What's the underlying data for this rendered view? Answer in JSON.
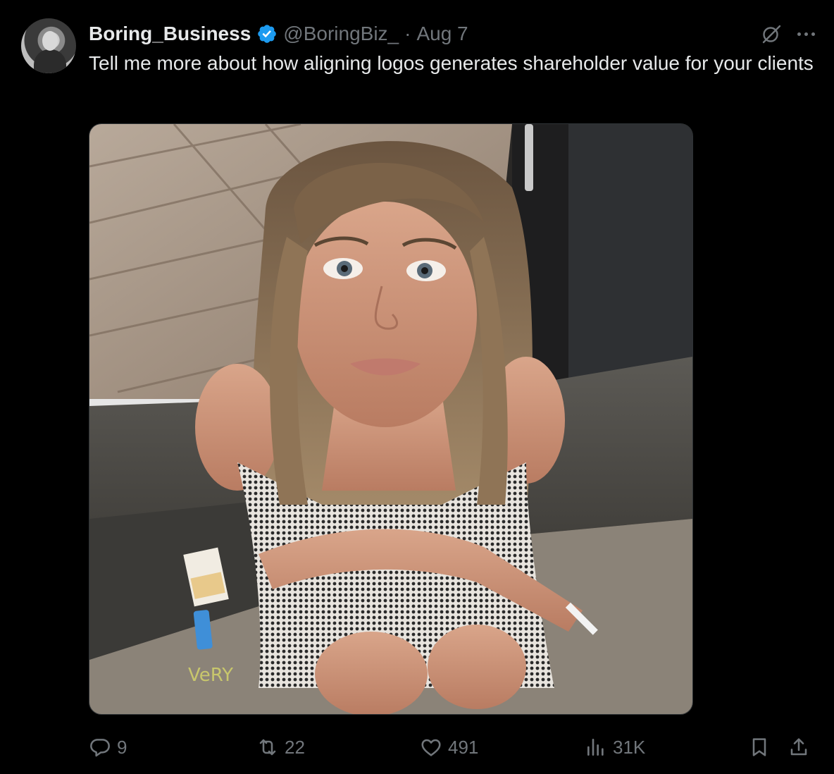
{
  "tweet": {
    "author_name": "Boring_Business",
    "handle": "@BoringBiz_",
    "separator": "·",
    "date": "Aug 7",
    "text": "Tell me more about how aligning logos generates shareholder value for your clients",
    "media_icons": {
      "verified": "verified-badge-icon",
      "grok": "grok-icon",
      "more": "more-icon"
    }
  },
  "media": {
    "scene_text": "VeRY"
  },
  "actions": {
    "replies": "9",
    "reposts": "22",
    "likes": "491",
    "views": "31K"
  },
  "colors": {
    "background": "#000000",
    "text": "#e7e9ea",
    "muted": "#71767b",
    "verified": "#1d9bf0"
  }
}
